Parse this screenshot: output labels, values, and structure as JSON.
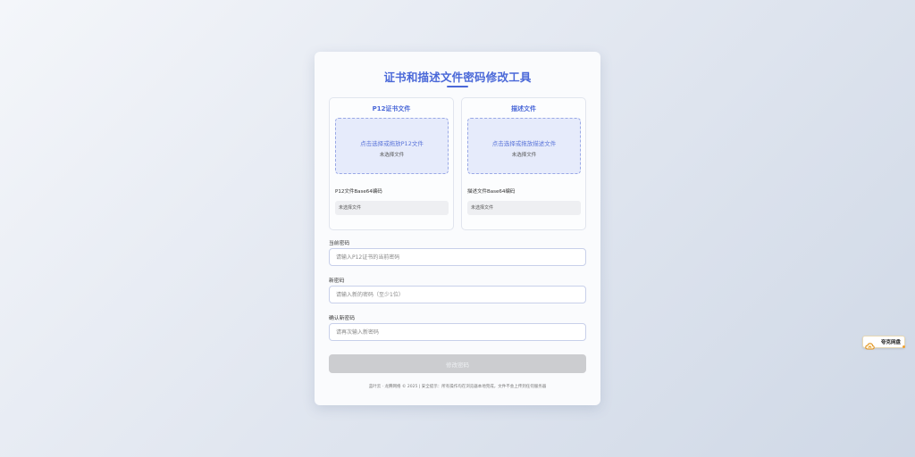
{
  "app": {
    "title": "证书和描述文件密码修改工具"
  },
  "panels": {
    "p12": {
      "title": "P12证书文件",
      "dropzone_text": "点击选择或拖放P12文件",
      "status_text": "未选择文件",
      "base64_label": "P12文件Base64编码",
      "base64_value": "未选择文件"
    },
    "profile": {
      "title": "描述文件",
      "dropzone_text": "点击选择或拖放描述文件",
      "status_text": "未选择文件",
      "base64_label": "描述文件Base64编码",
      "base64_value": "未选择文件"
    }
  },
  "form": {
    "current_password": {
      "label": "当前密码",
      "placeholder": "请输入P12证书的当前密码",
      "value": ""
    },
    "new_password": {
      "label": "新密码",
      "placeholder": "请输入新的密码（至少1位）",
      "value": ""
    },
    "confirm_password": {
      "label": "确认新密码",
      "placeholder": "请再次输入新密码",
      "value": ""
    },
    "submit_label": "修改密码"
  },
  "footer": {
    "text": "蓝叶云 · 龙腾网络 © 2025 | 安全提示：所有操作均在浏览器本地完成，文件不会上传到任何服务器"
  },
  "extension_widget": {
    "label": "夸克网盘",
    "icon": "cloud-icon"
  },
  "colors": {
    "accent": "#4a68d8",
    "dropzone_bg": "#e6ebfb",
    "disabled_button": "#cccdd0"
  }
}
